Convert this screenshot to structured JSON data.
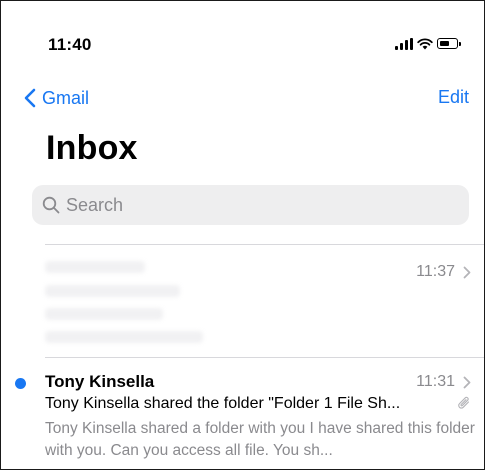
{
  "status_bar": {
    "time": "11:40",
    "icons": [
      "signal-icon",
      "wifi-icon",
      "battery-icon"
    ]
  },
  "nav": {
    "back_label": "Gmail",
    "edit_label": "Edit"
  },
  "title": "Inbox",
  "search": {
    "placeholder": "Search"
  },
  "messages": [
    {
      "faded": true,
      "time": "11:37"
    },
    {
      "unread": true,
      "sender": "Tony Kinsella",
      "time": "11:31",
      "subject": "Tony Kinsella shared the folder \"Folder 1 File Sh...",
      "preview": "Tony Kinsella shared a folder with you I have shared this folder with you. Can you access all file. You sh...",
      "has_attachment": true
    }
  ],
  "colors": {
    "accent": "#1877f2",
    "secondary_text": "#8a8a8e",
    "search_bg": "#eeeeef"
  }
}
